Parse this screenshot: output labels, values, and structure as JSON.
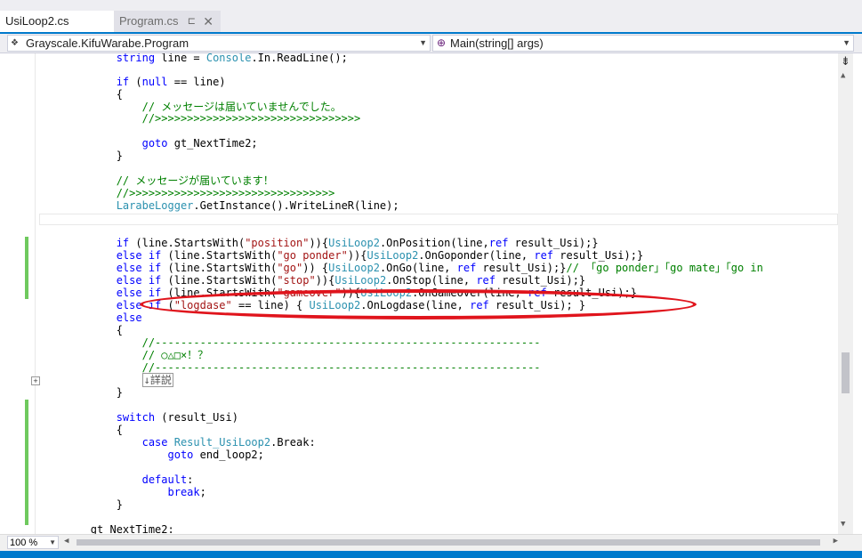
{
  "tabs": [
    {
      "label": "UsiLoop2.cs",
      "active": true
    },
    {
      "label": "Program.cs",
      "active": false,
      "pin_icon": "pin-icon",
      "close_glyph": "✕"
    }
  ],
  "nav": {
    "project": "Grayscale.KifuWarabe.Program",
    "member": "Main(string[] args)",
    "member_icon": "method-icon"
  },
  "zoom": "100 %",
  "colors": {
    "accent": "#007acc",
    "keyword": "#0000ff",
    "comment": "#008000",
    "string": "#a31515",
    "type": "#2b91af",
    "change_bar": "#6fc95e",
    "annotation_ellipse": "#e0141c"
  },
  "code": {
    "l1": [
      [
        "t",
        "            "
      ],
      [
        "k",
        "string"
      ],
      [
        "t",
        " line = "
      ],
      [
        "y",
        "Console"
      ],
      [
        "t",
        ".In.ReadLine();"
      ]
    ],
    "l2": [],
    "l3": [
      [
        "t",
        "            "
      ],
      [
        "k",
        "if"
      ],
      [
        "t",
        " ("
      ],
      [
        "k",
        "null"
      ],
      [
        "t",
        " == line)"
      ]
    ],
    "l4": [
      [
        "t",
        "            {"
      ]
    ],
    "l5": [
      [
        "t",
        "                "
      ],
      [
        "c",
        "// メッセージは届いていませんでした。"
      ]
    ],
    "l6": [
      [
        "t",
        "                "
      ],
      [
        "c",
        "//>>>>>>>>>>>>>>>>>>>>>>>>>>>>>>>>"
      ]
    ],
    "l7": [],
    "l8": [
      [
        "t",
        "                "
      ],
      [
        "k",
        "goto"
      ],
      [
        "t",
        " gt_NextTime2;"
      ]
    ],
    "l9": [
      [
        "t",
        "            }"
      ]
    ],
    "l10": [],
    "l11": [
      [
        "t",
        "            "
      ],
      [
        "c",
        "// メッセージが届いています！"
      ]
    ],
    "l12": [
      [
        "t",
        "            "
      ],
      [
        "c",
        "//>>>>>>>>>>>>>>>>>>>>>>>>>>>>>>>>"
      ]
    ],
    "l13": [
      [
        "y",
        "            LarabeLogger"
      ],
      [
        "t",
        ".GetInstance().WriteLineR(line);"
      ]
    ],
    "l14": [],
    "l15": [],
    "l16": [
      [
        "t",
        "            "
      ],
      [
        "k",
        "if"
      ],
      [
        "t",
        " (line.StartsWith("
      ],
      [
        "s",
        "\"position\""
      ],
      [
        "t",
        "))"
      ],
      [
        "y",
        "{UsiLoop2"
      ],
      [
        "t",
        ".OnPosition(line,"
      ],
      [
        "k",
        "ref"
      ],
      [
        "t",
        " result_Usi);}"
      ]
    ],
    "l17": [
      [
        "t",
        "            "
      ],
      [
        "k",
        "else if"
      ],
      [
        "t",
        " (line.StartsWith("
      ],
      [
        "s",
        "\"go ponder\""
      ],
      [
        "t",
        "))"
      ],
      [
        "y",
        "{UsiLoop2"
      ],
      [
        "t",
        ".OnGoponder(line, "
      ],
      [
        "k",
        "ref"
      ],
      [
        "t",
        " result_Usi);}"
      ]
    ],
    "l18": [
      [
        "t",
        "            "
      ],
      [
        "k",
        "else if"
      ],
      [
        "t",
        " (line.StartsWith("
      ],
      [
        "s",
        "\"go\""
      ],
      [
        "t",
        ")) {"
      ],
      [
        "y",
        "UsiLoop2"
      ],
      [
        "t",
        ".OnGo(line, "
      ],
      [
        "k",
        "ref"
      ],
      [
        "t",
        " result_Usi);}"
      ],
      [
        "c",
        "// 「go ponder」「go mate」「go in"
      ]
    ],
    "l19": [
      [
        "t",
        "            "
      ],
      [
        "k",
        "else if"
      ],
      [
        "t",
        " (line.StartsWith("
      ],
      [
        "s",
        "\"stop\""
      ],
      [
        "t",
        "))"
      ],
      [
        "y",
        "{UsiLoop2"
      ],
      [
        "t",
        ".OnStop(line, "
      ],
      [
        "k",
        "ref"
      ],
      [
        "t",
        " result_Usi);}"
      ]
    ],
    "l20": [
      [
        "t",
        "            "
      ],
      [
        "k",
        "else if"
      ],
      [
        "t",
        " (line.StartsWith("
      ],
      [
        "s",
        "\"gameover\""
      ],
      [
        "t",
        "))"
      ],
      [
        "y",
        "{UsiLoop2"
      ],
      [
        "t",
        ".OnGameover(line, "
      ],
      [
        "k",
        "ref"
      ],
      [
        "t",
        " result_Usi);}"
      ]
    ],
    "l21": [
      [
        "t",
        "            "
      ],
      [
        "k",
        "else if"
      ],
      [
        "t",
        " ("
      ],
      [
        "s",
        "\"logdase\""
      ],
      [
        "t",
        " == line) { "
      ],
      [
        "y",
        "UsiLoop2"
      ],
      [
        "t",
        ".OnLogdase(line, "
      ],
      [
        "k",
        "ref"
      ],
      [
        "t",
        " result_Usi); }"
      ]
    ],
    "l22": [
      [
        "t",
        "            "
      ],
      [
        "k",
        "else"
      ]
    ],
    "l23": [
      [
        "t",
        "            {"
      ]
    ],
    "l24": [
      [
        "t",
        "                "
      ],
      [
        "c",
        "//------------------------------------------------------------"
      ]
    ],
    "l25": [
      [
        "t",
        "                "
      ],
      [
        "c",
        "// ○△□×！？"
      ]
    ],
    "l26": [
      [
        "t",
        "                "
      ],
      [
        "c",
        "//------------------------------------------------------------"
      ]
    ],
    "l27": [
      [
        "t",
        "                "
      ],
      [
        "b",
        "↓詳説"
      ]
    ],
    "l28": [
      [
        "t",
        "            }"
      ]
    ],
    "l29": [],
    "l30": [
      [
        "t",
        "            "
      ],
      [
        "k",
        "switch"
      ],
      [
        "t",
        " (result_Usi)"
      ]
    ],
    "l31": [
      [
        "t",
        "            {"
      ]
    ],
    "l32": [
      [
        "t",
        "                "
      ],
      [
        "k",
        "case"
      ],
      [
        "t",
        " "
      ],
      [
        "y",
        "Result_UsiLoop2"
      ],
      [
        "t",
        ".Break:"
      ]
    ],
    "l33": [
      [
        "t",
        "                    "
      ],
      [
        "k",
        "goto"
      ],
      [
        "t",
        " end_loop2;"
      ]
    ],
    "l34": [],
    "l35": [
      [
        "t",
        "                "
      ],
      [
        "k",
        "default"
      ],
      [
        "t",
        ":"
      ]
    ],
    "l36": [
      [
        "t",
        "                    "
      ],
      [
        "k",
        "break"
      ],
      [
        "t",
        ";"
      ]
    ],
    "l37": [
      [
        "t",
        "            }"
      ]
    ],
    "l38": [],
    "l39": [
      [
        "t",
        "        gt_NextTime2:"
      ]
    ]
  }
}
